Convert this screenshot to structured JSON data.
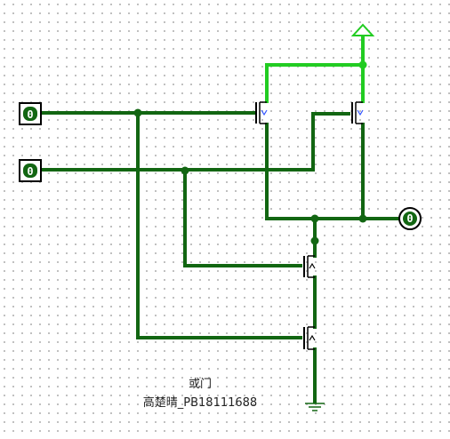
{
  "colors": {
    "wire_low": "#126612",
    "wire_high": "#22cc22",
    "ground": "#126612",
    "transistor": "#000000",
    "transistor_gate_mark": "#3355ff"
  },
  "inputs": [
    {
      "value": "0"
    },
    {
      "value": "0"
    }
  ],
  "output": {
    "value": "0"
  },
  "power_symbol": "power-triangle-icon",
  "ground_symbol": "ground-icon",
  "caption": {
    "title": "或门",
    "author": "高楚晴_PB18111688"
  }
}
